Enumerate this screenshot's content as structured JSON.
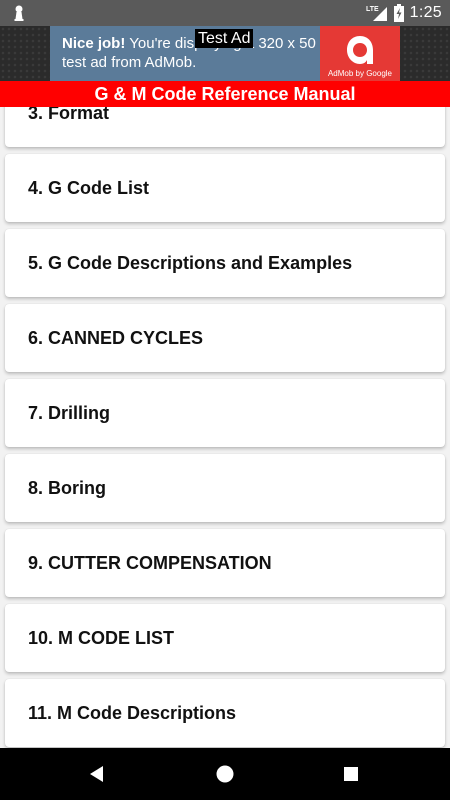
{
  "status_bar": {
    "time": "1:25",
    "network_label": "LTE"
  },
  "ad": {
    "label": "Test Ad",
    "headline": "Nice job!",
    "body": "You're displaying a 320 x 50 test ad from AdMob.",
    "byline": "AdMob by Google"
  },
  "header": {
    "title": "G & M Code Reference Manual"
  },
  "list": {
    "items": [
      {
        "label": "3. Format"
      },
      {
        "label": "4. G Code List"
      },
      {
        "label": "5. G Code Descriptions and Examples"
      },
      {
        "label": "6. CANNED CYCLES"
      },
      {
        "label": "7. Drilling"
      },
      {
        "label": "8. Boring"
      },
      {
        "label": "9. CUTTER COMPENSATION"
      },
      {
        "label": "10. M CODE LIST"
      },
      {
        "label": "11. M Code Descriptions"
      }
    ]
  },
  "colors": {
    "title_bar": "#ff0000",
    "ad_background": "#5b7b99",
    "ad_logo": "#e53935",
    "status_bar": "#5a5a5a",
    "nav_bar": "#000000"
  }
}
